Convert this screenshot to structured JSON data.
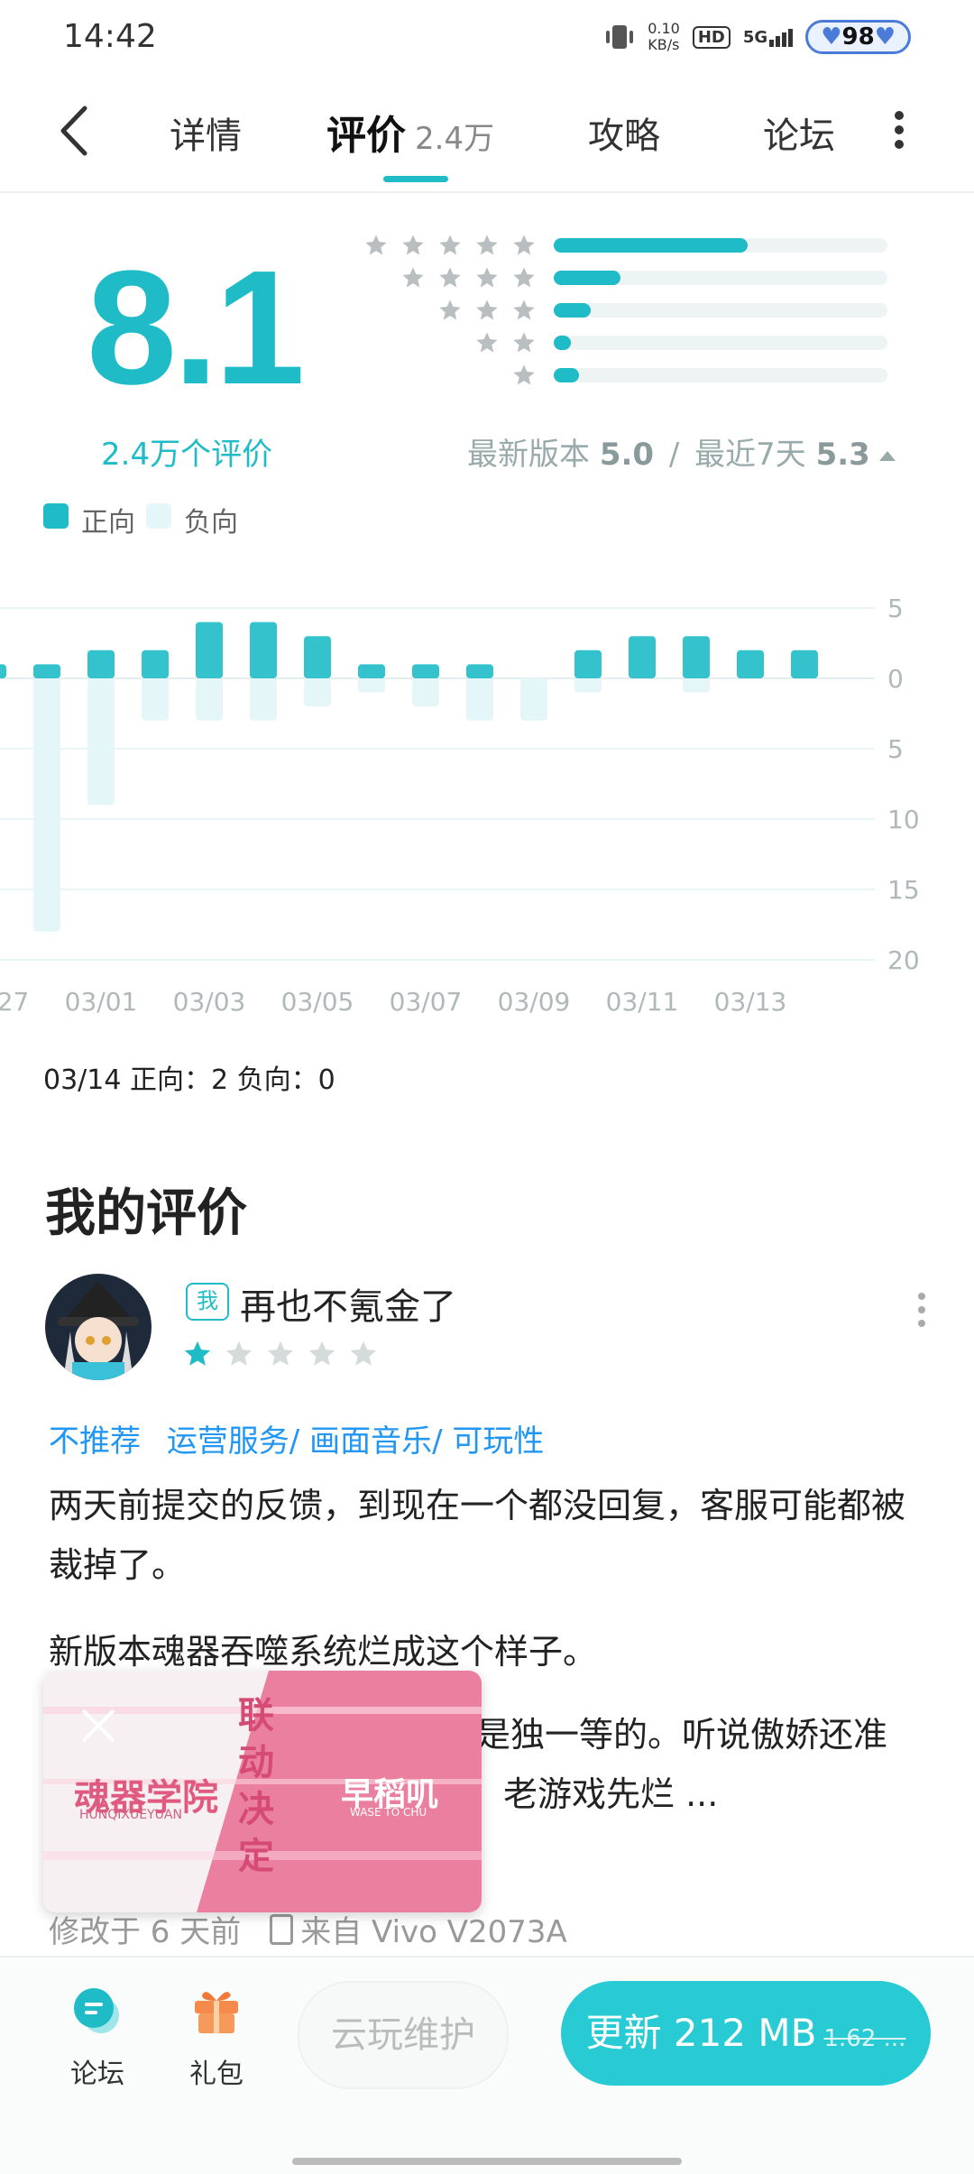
{
  "status": {
    "time": "14:42",
    "net_speed": "0.10",
    "net_unit": "KB/s",
    "hd": "HD",
    "signal": "5G",
    "battery": "98"
  },
  "tabs": [
    {
      "label": "详情"
    },
    {
      "label": "评价",
      "count": "2.4万"
    },
    {
      "label": "攻略"
    },
    {
      "label": "论坛"
    }
  ],
  "rating": {
    "score": "8.1",
    "count_text": "2.4万个评价",
    "latest_label": "最新版本",
    "latest_value": "5.0",
    "sep": "/",
    "recent_label": "最近7天",
    "recent_value": "5.3",
    "distribution": [
      {
        "stars": 5,
        "fraction": 0.58
      },
      {
        "stars": 4,
        "fraction": 0.2
      },
      {
        "stars": 3,
        "fraction": 0.11
      },
      {
        "stars": 2,
        "fraction": 0.05
      },
      {
        "stars": 1,
        "fraction": 0.075
      }
    ]
  },
  "legend": {
    "positive": "正向",
    "negative": "负向"
  },
  "colors": {
    "accent": "#1fbcc8",
    "positive_bar": "#34c3cc",
    "negative_bar": "#e4f6f8",
    "link": "#2196f3"
  },
  "chart_data": {
    "type": "bar",
    "categories": [
      "02/27",
      "02/28",
      "03/01",
      "03/02",
      "03/03",
      "03/04",
      "03/05",
      "03/06",
      "03/07",
      "03/08",
      "03/09",
      "03/10",
      "03/11",
      "03/12",
      "03/13",
      "03/14"
    ],
    "x_tick_labels": [
      "02/27",
      "03/01",
      "03/03",
      "03/05",
      "03/07",
      "03/09",
      "03/11",
      "03/13"
    ],
    "y_tick_labels": [
      "5",
      "0",
      "5",
      "10",
      "15",
      "20"
    ],
    "series": [
      {
        "name": "正向",
        "values": [
          1,
          1,
          2,
          2,
          4,
          4,
          3,
          1,
          1,
          1,
          0,
          2,
          3,
          3,
          2,
          2
        ]
      },
      {
        "name": "负向",
        "values": [
          0,
          18,
          9,
          3,
          3,
          3,
          2,
          1,
          2,
          3,
          3,
          1,
          0,
          1,
          0,
          0
        ]
      }
    ],
    "ylim": [
      -20,
      5
    ],
    "grid": true
  },
  "day_info": "03/14 正向：2  负向：0",
  "review": {
    "section_title": "我的评价",
    "me_badge": "我",
    "username": "再也不氪金了",
    "stars": 1,
    "max_stars": 5,
    "tag_negative": "不推荐",
    "tag_topics": "运营服务/ 画面音乐/ 可玩性",
    "para1": "两天前提交的反馈，到现在一个都没回复，客服可能都被裁掉了。",
    "para2": "新版本魂器吞噬系统烂成这个样子。",
    "para3_visible": "是独一等的。听说傲娇还准",
    "para4_visible": "老游戏先烂 ...",
    "modified": "修改于 6 天前",
    "device": "来自 Vivo V2073A"
  },
  "ad": {
    "title_left": "魂器学院",
    "subtitle_left": "HUNQIXUEYUAN",
    "title_mid": "联动决定",
    "title_right": "早稻叽",
    "subtitle_right": "WASE TO CHU"
  },
  "bottom": {
    "forum_label": "论坛",
    "gift_label": "礼包",
    "cloud_label": "云玩维护",
    "update_label": "更新 212 MB",
    "update_old": "1.62 ..."
  }
}
